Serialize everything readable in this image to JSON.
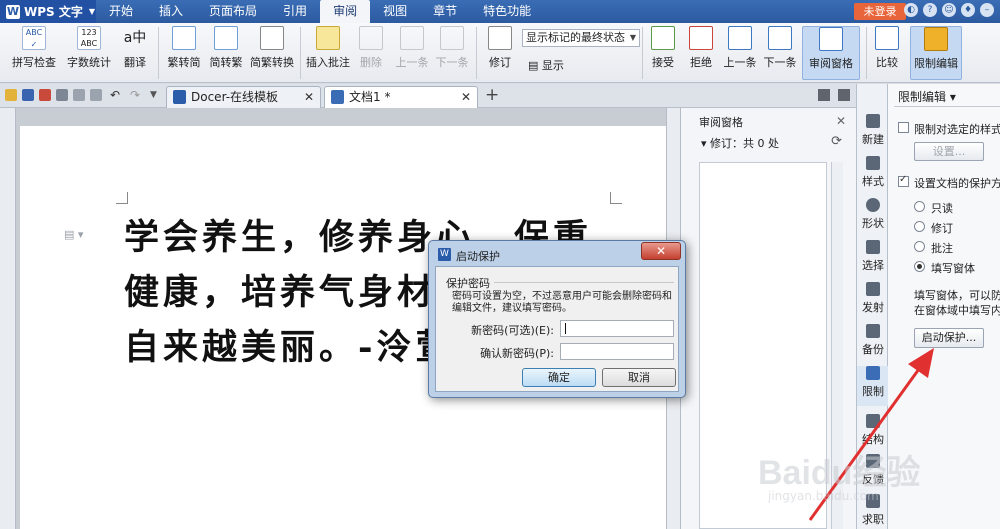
{
  "app": {
    "name": "WPS 文字"
  },
  "menu": {
    "tabs": [
      "开始",
      "插入",
      "页面布局",
      "引用",
      "审阅",
      "视图",
      "章节",
      "特色功能"
    ],
    "login": "未登录"
  },
  "ribbon": {
    "spell": "拼写检查",
    "wordcount": "字数统计",
    "translate": "翻译",
    "trad_simp": "繁转简",
    "simp_trad": "简转繁",
    "convert": "简繁转换",
    "insert_comment": "插入批注",
    "delete": "删除",
    "prev_comment": "上一条",
    "next_comment": "下一条",
    "revise": "修订",
    "markup_select": "显示标记的最终状态",
    "show": "显示",
    "accept": "接受",
    "reject": "拒绝",
    "prev": "上一条",
    "next": "下一条",
    "review_pane": "审阅窗格",
    "compare": "比较",
    "restrict": "限制编辑"
  },
  "tabs": {
    "template": "Docer-在线模板",
    "doc": "文档1 *"
  },
  "document": {
    "text": "学会养生，修养身心，保重健康，培养气身材，赚钱够自来越美丽。-泠萱雨梦"
  },
  "review_pane": {
    "title": "审阅窗格",
    "revisions": "修订：共 0 处"
  },
  "sidebar": {
    "items": [
      "新建",
      "样式",
      "形状",
      "选择",
      "发射",
      "备份",
      "限制",
      "结构",
      "反馈",
      "求职"
    ]
  },
  "restrict_panel": {
    "title": "限制编辑",
    "limit_format": "限制对选定的样式",
    "settings_btn": "设置...",
    "set_protect": "设置文档的保护方",
    "opt_readonly": "只读",
    "opt_revise": "修订",
    "opt_comment": "批注",
    "opt_form": "填写窗体",
    "desc_line1": "填写窗体，可以防",
    "desc_line2": "在窗体域中填写内",
    "start_btn": "启动保护..."
  },
  "dialog": {
    "title": "启动保护",
    "close": "✕",
    "group": "保护密码",
    "hint": "密码可设置为空，不过恶意用户可能会删除密码和编辑文件，建议填写密码。",
    "new_pwd_label": "新密码(可选)(E):",
    "confirm_pwd_label": "确认新密码(P):",
    "new_pwd_value": "",
    "confirm_pwd_value": "",
    "ok": "确定",
    "cancel": "取消"
  },
  "watermark": {
    "brand": "Baidu经验",
    "url": "jingyan.baidu.com"
  },
  "colors": {
    "title_bar": "#2c5aa0",
    "login": "#e8643a",
    "arrow": "#e03030"
  }
}
